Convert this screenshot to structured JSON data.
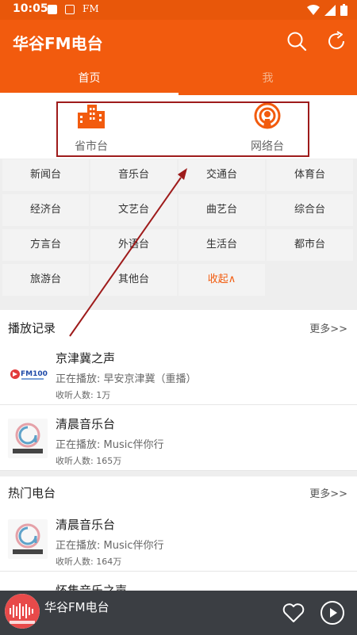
{
  "status": {
    "time": "10:05",
    "fm": "FM"
  },
  "header": {
    "title": "华谷FM电台"
  },
  "tabs": [
    {
      "label": "首页"
    },
    {
      "label": "我"
    }
  ],
  "categories": [
    {
      "label": "省市台"
    },
    {
      "label": "网络台"
    }
  ],
  "grid": [
    "新闻台",
    "音乐台",
    "交通台",
    "体育台",
    "经济台",
    "文艺台",
    "曲艺台",
    "综合台",
    "方言台",
    "外语台",
    "生活台",
    "都市台",
    "旅游台",
    "其他台",
    "收起∧"
  ],
  "history": {
    "title": "播放记录",
    "more": "更多>>",
    "items": [
      {
        "name": "京津冀之声",
        "now": "正在播放: 早安京津冀（重播）",
        "count": "收听人数: 1万"
      },
      {
        "name": "清晨音乐台",
        "now": "正在播放: Music伴你行",
        "count": "收听人数: 165万"
      }
    ]
  },
  "hot": {
    "title": "热门电台",
    "more": "更多>>",
    "items": [
      {
        "name": "清晨音乐台",
        "now": "正在播放: Music伴你行",
        "count": "收听人数: 164万"
      },
      {
        "name": "怀集音乐之声"
      }
    ]
  },
  "player": {
    "title": "华谷FM电台"
  },
  "colors": {
    "brand": "#f25b0e",
    "highlight": "#9e1b1b"
  }
}
